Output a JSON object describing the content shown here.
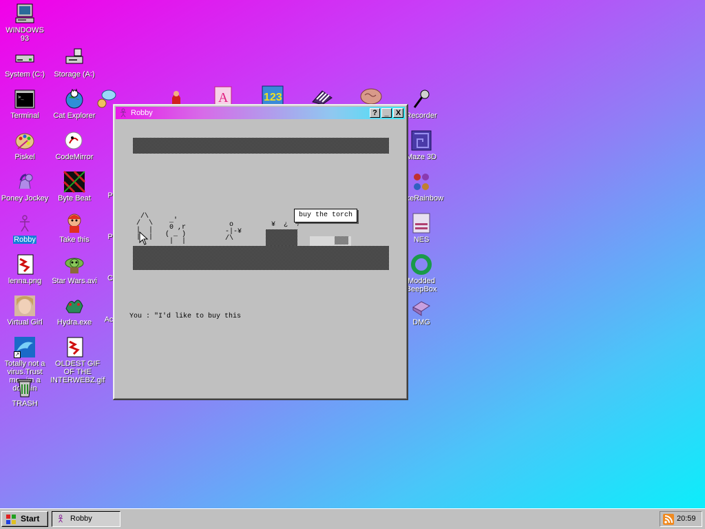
{
  "desktop": {
    "icons": [
      {
        "label": "WINDOWS 93",
        "icon": "windows93-computer-icon"
      },
      {
        "label": "System (C:)",
        "icon": "hard-drive-icon"
      },
      {
        "label": "Storage (A:)",
        "icon": "floppy-drive-icon"
      },
      {
        "label": "Terminal",
        "icon": "terminal-icon"
      },
      {
        "label": "Cat Explorer",
        "icon": "cat-globe-icon"
      },
      {
        "label": "Piskel",
        "icon": "paint-palette-icon"
      },
      {
        "label": "CodeMirror",
        "icon": "codemirror-icon"
      },
      {
        "label": "Poney Jockey",
        "icon": "pony-icon"
      },
      {
        "label": "Byte Beat",
        "icon": "bytebeat-icon"
      },
      {
        "label": "Robby",
        "icon": "robby-stickman-icon"
      },
      {
        "label": "Take this",
        "icon": "take-this-icon"
      },
      {
        "label": "lenna.png",
        "icon": "image-file-icon"
      },
      {
        "label": "Star Wars.avi",
        "icon": "yoda-video-icon"
      },
      {
        "label": "Virtual Girl",
        "icon": "virtual-girl-icon"
      },
      {
        "label": "Hydra.exe",
        "icon": "hydra-icon"
      },
      {
        "label": "Totally not a virus.Trust me...im a dolphin",
        "icon": "dolphin-icon"
      },
      {
        "label": "OLDEST GIF OF THE INTERWEBZ.gif",
        "icon": "gif-file-icon"
      },
      {
        "label": "TRASH",
        "icon": "trash-icon"
      },
      {
        "label": "Recorder",
        "icon": "microphone-icon"
      },
      {
        "label": "Maze 3D",
        "icon": "maze-icon"
      },
      {
        "label": "BikeRainbow",
        "icon": "rainbow-bikers-icon"
      },
      {
        "label": "NES",
        "icon": "nes-console-icon"
      },
      {
        "label": "Modded BeepBox",
        "icon": "beepbox-ring-icon"
      },
      {
        "label": "DMG",
        "icon": "dmg-disk-icon"
      },
      {
        "label": "T",
        "icon": "chat-bubble-icon"
      },
      {
        "label": "P",
        "icon": "partial-icon"
      },
      {
        "label": "P",
        "icon": "partial-icon"
      },
      {
        "label": "C",
        "icon": "partial-icon"
      },
      {
        "label": "Ac",
        "icon": "partial-icon"
      }
    ],
    "behind_window_icons": [
      "mario-icon",
      "font-letter-a-icon",
      "calculator-123-icon",
      "piano-keys-icon",
      "brain-icon"
    ]
  },
  "window": {
    "title": "Robby",
    "help_label": "?",
    "minimize_label": "_",
    "close_label": "X",
    "tooltip": "buy the torch",
    "dialog": "You : \"I'd like to buy this",
    "ascii": {
      "house": "  /\\\n /  \\\n |  |\n |  |",
      "creature": "  _'\n  0 ,r\n ( _ )\n  |  |",
      "stickman": "  o\n -|-¥\n /\\",
      "shop": "¥  ¿  ?"
    }
  },
  "taskbar": {
    "start_label": "Start",
    "open_window_label": "Robby",
    "clock": "20:59"
  }
}
